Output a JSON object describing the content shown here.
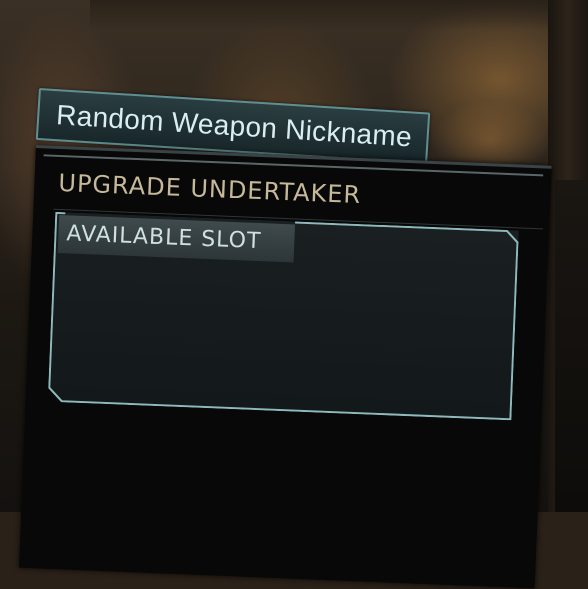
{
  "weapon": {
    "nickname": "Random Weapon Nickname"
  },
  "upgrade_panel": {
    "title": "UPGRADE UNDERTAKER",
    "slot_label": "AVAILABLE SLOT"
  },
  "colors": {
    "accent": "#5f8f93",
    "title_text": "#c6b99a",
    "slot_text": "#cfe0e2",
    "panel_bg": "#070807"
  }
}
